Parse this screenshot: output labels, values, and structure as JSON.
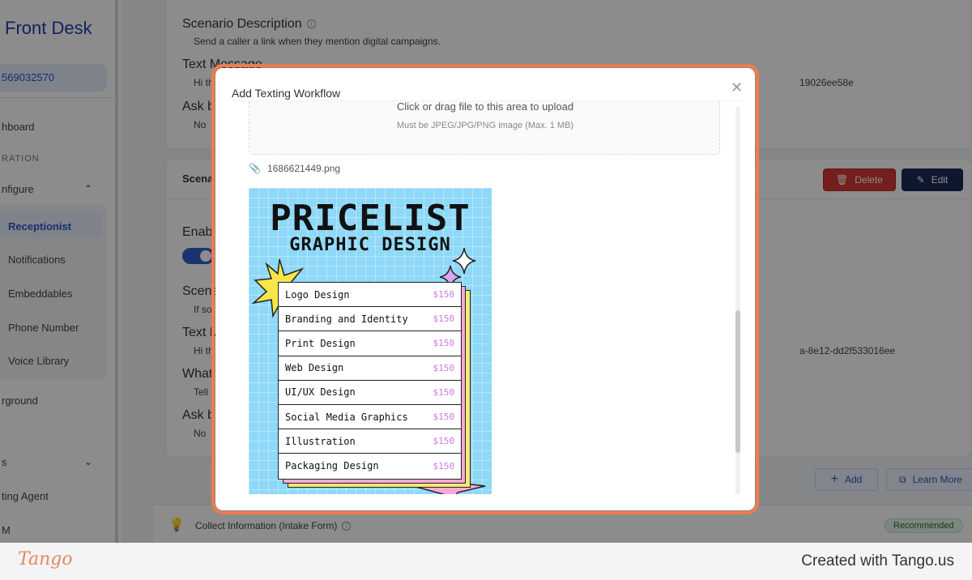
{
  "sidebar": {
    "brand": "Front Desk",
    "account": "569032570",
    "items": [
      {
        "label": "hboard"
      },
      {
        "label": "RATION"
      },
      {
        "label": "nfigure"
      },
      {
        "label": "rground"
      },
      {
        "label": "s"
      },
      {
        "label": "ting Agent"
      },
      {
        "label": "M"
      }
    ],
    "sub_items": [
      {
        "label": "Receptionist"
      },
      {
        "label": "Notifications"
      },
      {
        "label": "Embeddables"
      },
      {
        "label": "Phone Number"
      },
      {
        "label": "Voice Library"
      }
    ]
  },
  "scenario1": {
    "desc_label": "Scenario Description",
    "desc_value": "Send a caller a link when they mention digital campaigns.",
    "text_label": "Text Message",
    "text_value": "Hi th",
    "text_code": "19026ee58e",
    "ask_label": "Ask b",
    "ask_value": "No"
  },
  "scenario2": {
    "header": "Scena",
    "enable_label": "Enab",
    "scen_label": "Scena",
    "scen_value": "If so",
    "text_label": "Text M",
    "text_value": "Hi th",
    "text_code": "a-8e12-dd2f533016ee",
    "what_label": "What",
    "what_value": "Tell",
    "ask_label": "Ask b",
    "ask_value": "No",
    "delete_label": "Delete",
    "edit_label": "Edit"
  },
  "actions": {
    "add_label": "Add",
    "learn_label": "Learn More"
  },
  "intake": {
    "label": "Collect Information (Intake Form)",
    "badge": "Recommended"
  },
  "modal": {
    "title": "Add Texting Workflow",
    "upload_text": "Click or drag file to this area to upload",
    "upload_hint": "Must be JPEG/JPG/PNG image (Max. 1 MB)",
    "file_name": "1686621449.png"
  },
  "preview": {
    "title": "PRICELIST",
    "subtitle": "GRAPHIC DESIGN",
    "rows": [
      {
        "name": "Logo Design",
        "price": "$150"
      },
      {
        "name": "Branding and Identity",
        "price": "$150"
      },
      {
        "name": "Print Design",
        "price": "$150"
      },
      {
        "name": "Web Design",
        "price": "$150"
      },
      {
        "name": "UI/UX Design",
        "price": "$150"
      },
      {
        "name": "Social Media Graphics",
        "price": "$150"
      },
      {
        "name": "Illustration",
        "price": "$150"
      },
      {
        "name": "Packaging Design",
        "price": "$150"
      }
    ]
  },
  "footer": {
    "logo": "Tango",
    "credit": "Created with Tango.us"
  },
  "colors": {
    "accent": "#2a56c6",
    "modal_border": "#f07b4a",
    "delete": "#d63838",
    "edit": "#1c2a55"
  }
}
